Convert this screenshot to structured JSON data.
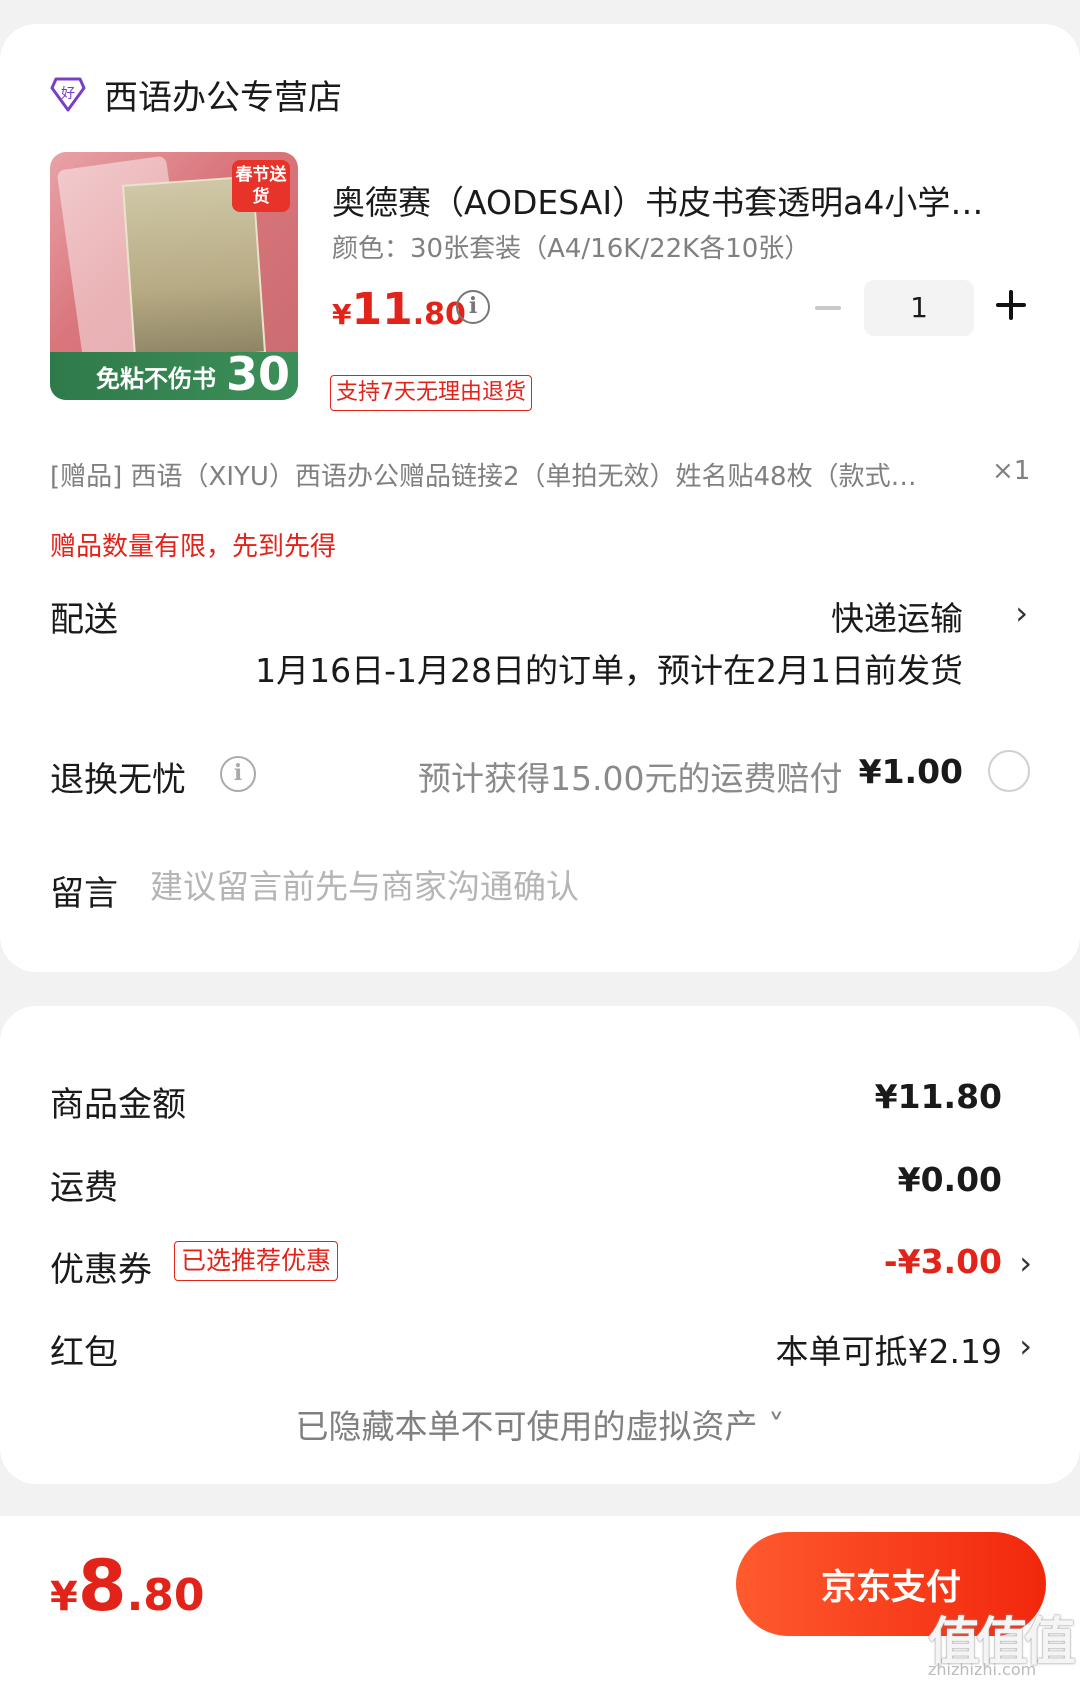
{
  "store": {
    "name": "西语办公专营店",
    "icon": "store-badge-icon",
    "icon_glyph": "好"
  },
  "product": {
    "title": "奥德赛（AODESAI）书皮书套透明a4小学…",
    "variant": "颜色：30张套装（A4/16K/22K各10张）",
    "price": {
      "currency": "¥",
      "integer": "11",
      "decimal": ".80"
    },
    "quantity": "1",
    "return_policy": "支持7天无理由退货",
    "image": {
      "badge": "春节送货",
      "caption": "免粘不伤书",
      "count": "30"
    }
  },
  "gift": {
    "line": "[赠品]  西语（XIYU）西语办公赠品链接2（单拍无效）姓名贴48枚（款式…",
    "qty": "×1",
    "note": "赠品数量有限，先到先得"
  },
  "delivery": {
    "label": "配送",
    "method": "快递运输",
    "schedule": "1月16日-1月28日的订单，预计在2月1日前发货"
  },
  "worry_free": {
    "label": "退换无忧",
    "description": "预计获得15.00元的运费赔付",
    "price": "¥1.00",
    "selected": false
  },
  "memo": {
    "label": "留言",
    "placeholder": "建议留言前先与商家沟通确认"
  },
  "summary": {
    "goods_label": "商品金额",
    "goods_value": "¥11.80",
    "shipping_label": "运费",
    "shipping_value": "¥0.00",
    "coupon_label": "优惠券",
    "coupon_tag": "已选推荐优惠",
    "coupon_value": "-¥3.00",
    "red_packet_label": "红包",
    "red_packet_value": "本单可抵¥2.19",
    "hidden_assets": "已隐藏本单不可使用的虚拟资产 ˅"
  },
  "footer": {
    "total": {
      "currency": "¥",
      "integer": "8",
      "decimal": ".80"
    },
    "pay_label": "京东支付",
    "watermark": "值值值",
    "watermark_url": "zhizhizhi.com"
  },
  "colors": {
    "accent": "#e2231a",
    "pay_gradient_start": "#ff5a2e",
    "pay_gradient_end": "#f2270c"
  }
}
